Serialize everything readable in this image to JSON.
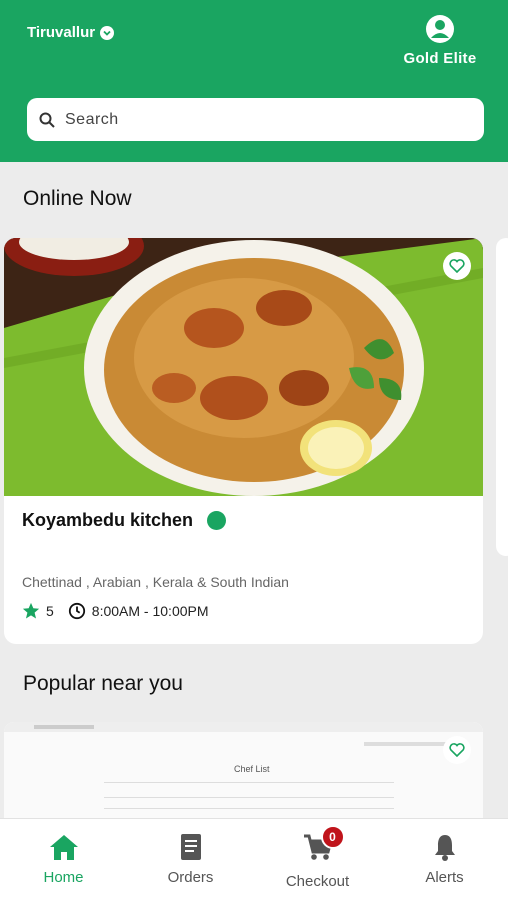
{
  "header": {
    "location": "Tiruvallur",
    "profile_label": "Gold Elite",
    "search_placeholder": "Search"
  },
  "sections": {
    "online_now": "Online Now",
    "popular": "Popular near you"
  },
  "restaurant": {
    "name": "Koyambedu kitchen",
    "cuisine": "Chettinad , Arabian , Kerala & South Indian",
    "rating": "5",
    "hours": "8:00AM - 10:00PM"
  },
  "popular_preview": {
    "title": "Chef List"
  },
  "nav": {
    "home": "Home",
    "orders": "Orders",
    "checkout": "Checkout",
    "checkout_badge": "0",
    "alerts": "Alerts"
  },
  "colors": {
    "brand": "#1aa561",
    "badge": "#c0141b"
  }
}
